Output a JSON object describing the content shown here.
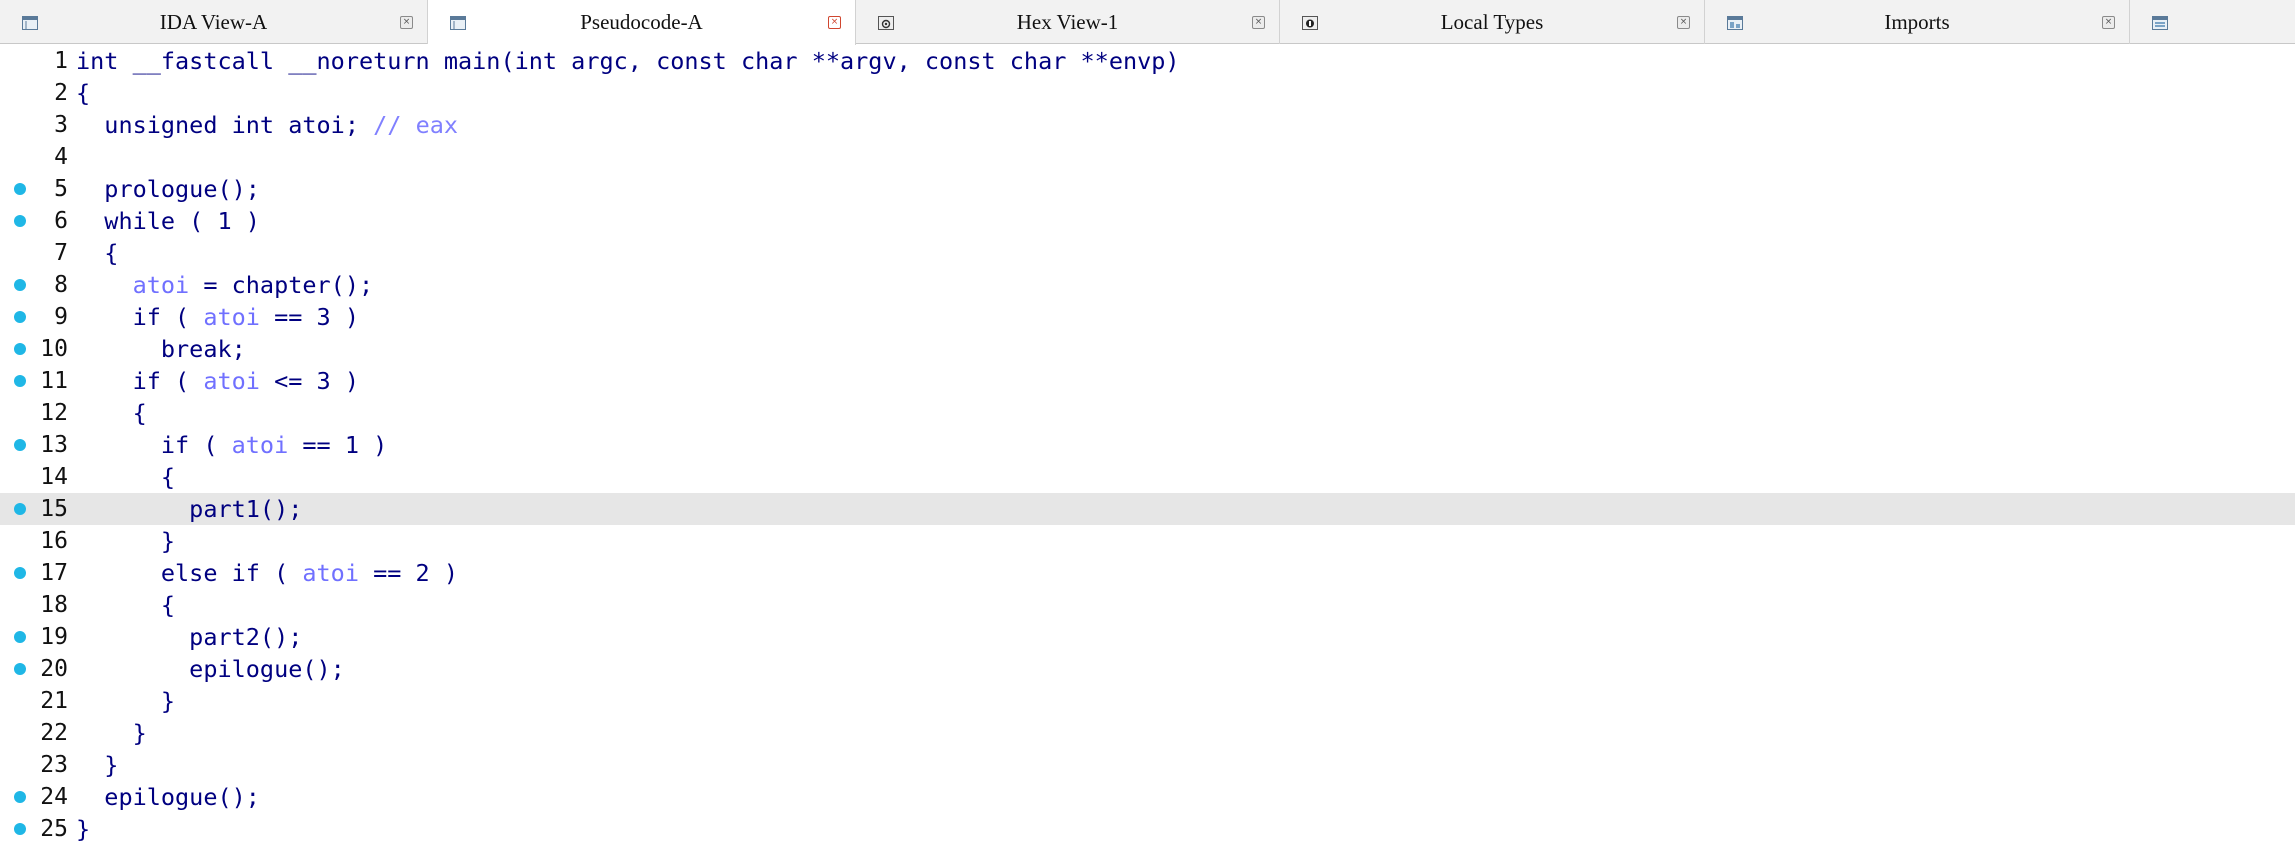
{
  "tabs": [
    {
      "label": "IDA View-A",
      "icon": "ida-view-icon",
      "active": false
    },
    {
      "label": "Pseudocode-A",
      "icon": "pseudocode-icon",
      "active": true
    },
    {
      "label": "Hex View-1",
      "icon": "hex-view-icon",
      "active": false
    },
    {
      "label": "Local Types",
      "icon": "local-types-icon",
      "active": false
    },
    {
      "label": "Imports",
      "icon": "imports-icon",
      "active": false
    }
  ],
  "colors": {
    "keyword": "#000080",
    "variable": "#7070ff",
    "comment": "#8080ff",
    "breakpoint": "#1fb7e6",
    "highlight": "#e6e6e6"
  },
  "code": {
    "lines": [
      {
        "n": "1",
        "bp": false,
        "hl": false,
        "t": [
          [
            "int __fastcall __noreturn main(int argc, const char **argv, const char **envp)",
            "k"
          ]
        ]
      },
      {
        "n": "2",
        "bp": false,
        "hl": false,
        "t": [
          [
            "{",
            "k"
          ]
        ]
      },
      {
        "n": "3",
        "bp": false,
        "hl": false,
        "t": [
          [
            "  unsigned int atoi; ",
            "k"
          ],
          [
            "// eax",
            "c"
          ]
        ]
      },
      {
        "n": "4",
        "bp": false,
        "hl": false,
        "t": []
      },
      {
        "n": "5",
        "bp": true,
        "hl": false,
        "t": [
          [
            "  prologue();",
            "k"
          ]
        ]
      },
      {
        "n": "6",
        "bp": true,
        "hl": false,
        "t": [
          [
            "  while ( 1 )",
            "k"
          ]
        ]
      },
      {
        "n": "7",
        "bp": false,
        "hl": false,
        "t": [
          [
            "  {",
            "k"
          ]
        ]
      },
      {
        "n": "8",
        "bp": true,
        "hl": false,
        "t": [
          [
            "    ",
            "k"
          ],
          [
            "atoi",
            "v"
          ],
          [
            " = chapter();",
            "k"
          ]
        ]
      },
      {
        "n": "9",
        "bp": true,
        "hl": false,
        "t": [
          [
            "    if ( ",
            "k"
          ],
          [
            "atoi",
            "v"
          ],
          [
            " == 3 )",
            "k"
          ]
        ]
      },
      {
        "n": "10",
        "bp": true,
        "hl": false,
        "t": [
          [
            "      break;",
            "k"
          ]
        ]
      },
      {
        "n": "11",
        "bp": true,
        "hl": false,
        "t": [
          [
            "    if ( ",
            "k"
          ],
          [
            "atoi",
            "v"
          ],
          [
            " <= 3 )",
            "k"
          ]
        ]
      },
      {
        "n": "12",
        "bp": false,
        "hl": false,
        "t": [
          [
            "    {",
            "k"
          ]
        ]
      },
      {
        "n": "13",
        "bp": true,
        "hl": false,
        "t": [
          [
            "      if ( ",
            "k"
          ],
          [
            "atoi",
            "v"
          ],
          [
            " == 1 )",
            "k"
          ]
        ]
      },
      {
        "n": "14",
        "bp": false,
        "hl": false,
        "t": [
          [
            "      {",
            "k"
          ]
        ]
      },
      {
        "n": "15",
        "bp": true,
        "hl": true,
        "t": [
          [
            "        part1();",
            "k"
          ]
        ]
      },
      {
        "n": "16",
        "bp": false,
        "hl": false,
        "t": [
          [
            "      }",
            "k"
          ]
        ]
      },
      {
        "n": "17",
        "bp": true,
        "hl": false,
        "t": [
          [
            "      else if ( ",
            "k"
          ],
          [
            "atoi",
            "v"
          ],
          [
            " == 2 )",
            "k"
          ]
        ]
      },
      {
        "n": "18",
        "bp": false,
        "hl": false,
        "t": [
          [
            "      {",
            "k"
          ]
        ]
      },
      {
        "n": "19",
        "bp": true,
        "hl": false,
        "t": [
          [
            "        part2();",
            "k"
          ]
        ]
      },
      {
        "n": "20",
        "bp": true,
        "hl": false,
        "t": [
          [
            "        epilogue();",
            "k"
          ]
        ]
      },
      {
        "n": "21",
        "bp": false,
        "hl": false,
        "t": [
          [
            "      }",
            "k"
          ]
        ]
      },
      {
        "n": "22",
        "bp": false,
        "hl": false,
        "t": [
          [
            "    }",
            "k"
          ]
        ]
      },
      {
        "n": "23",
        "bp": false,
        "hl": false,
        "t": [
          [
            "  }",
            "k"
          ]
        ]
      },
      {
        "n": "24",
        "bp": true,
        "hl": false,
        "t": [
          [
            "  epilogue();",
            "k"
          ]
        ]
      },
      {
        "n": "25",
        "bp": true,
        "hl": false,
        "t": [
          [
            "}",
            "k"
          ]
        ]
      }
    ]
  }
}
